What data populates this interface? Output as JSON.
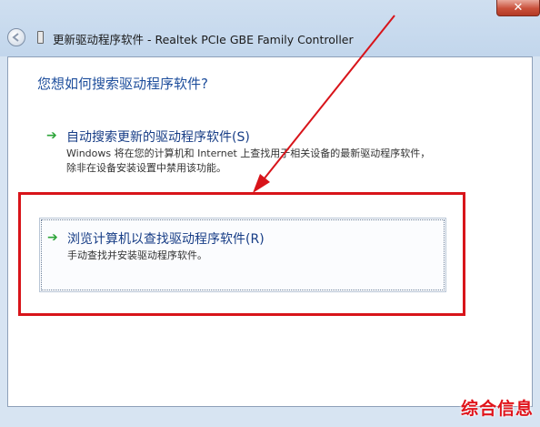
{
  "window": {
    "title": "更新驱动程序软件 - Realtek PCIe GBE Family Controller",
    "close_label": "✕"
  },
  "main": {
    "heading": "您想如何搜索驱动程序软件?",
    "options": [
      {
        "title": "自动搜索更新的驱动程序软件(S)",
        "description": "Windows 将在您的计算机和 Internet 上查找用于相关设备的最新驱动程序软件，除非在设备安装设置中禁用该功能。"
      },
      {
        "title": "浏览计算机以查找驱动程序软件(R)",
        "description": "手动查找并安装驱动程序软件。"
      }
    ]
  },
  "icons": {
    "back": "back-arrow-icon",
    "device": "device-icon",
    "option_arrow": "green-arrow-icon"
  },
  "colors": {
    "heading": "#1e4e9c",
    "link": "#173d86",
    "arrow": "#2ea53a",
    "annotation": "#d8141a"
  },
  "watermark": "综合信息"
}
